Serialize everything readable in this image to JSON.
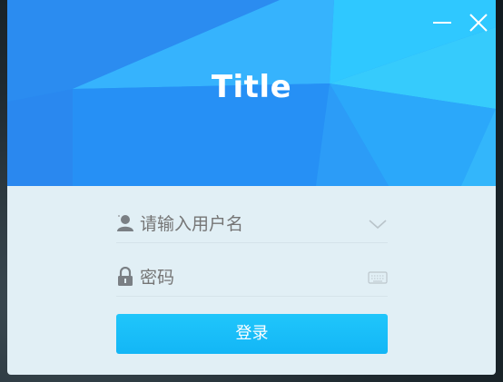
{
  "window": {
    "title": "Title",
    "minimize_icon": "minimize-icon",
    "close_icon": "close-icon"
  },
  "form": {
    "username": {
      "value": "",
      "placeholder": "请输入用户名",
      "lead_icon": "user-icon",
      "trail_icon": "chevron-down-icon"
    },
    "password": {
      "value": "",
      "placeholder": "密码",
      "lead_icon": "lock-icon",
      "trail_icon": "keyboard-icon"
    },
    "login_label": "登录"
  },
  "colors": {
    "header_blue": "#2795f5",
    "header_light": "#31c5ff",
    "panel_bg": "#e1eff5",
    "button": "#15b9f7",
    "placeholder_text": "#777c80"
  }
}
